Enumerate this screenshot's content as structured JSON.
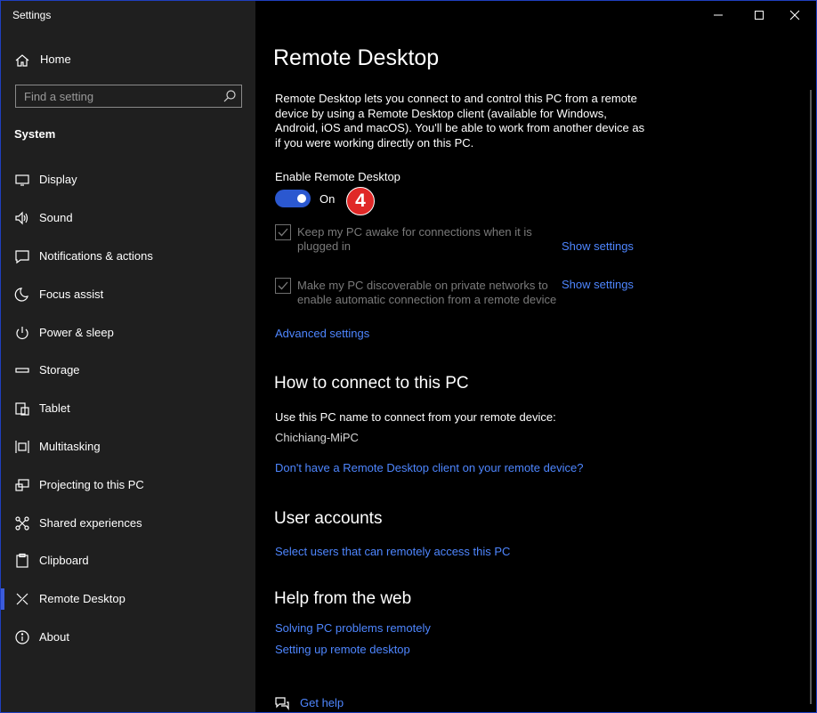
{
  "window": {
    "title": "Settings"
  },
  "sidebar": {
    "home_label": "Home",
    "search_placeholder": "Find a setting",
    "section_title": "System",
    "items": [
      {
        "label": "Display",
        "icon": "display-icon"
      },
      {
        "label": "Sound",
        "icon": "sound-icon"
      },
      {
        "label": "Notifications & actions",
        "icon": "notifications-icon"
      },
      {
        "label": "Focus assist",
        "icon": "moon-icon"
      },
      {
        "label": "Power & sleep",
        "icon": "power-icon"
      },
      {
        "label": "Storage",
        "icon": "storage-icon"
      },
      {
        "label": "Tablet",
        "icon": "tablet-icon"
      },
      {
        "label": "Multitasking",
        "icon": "multitasking-icon"
      },
      {
        "label": "Projecting to this PC",
        "icon": "projecting-icon"
      },
      {
        "label": "Shared experiences",
        "icon": "shared-icon"
      },
      {
        "label": "Clipboard",
        "icon": "clipboard-icon"
      },
      {
        "label": "Remote Desktop",
        "icon": "remote-desktop-icon",
        "active": true
      },
      {
        "label": "About",
        "icon": "info-icon"
      }
    ]
  },
  "main": {
    "title": "Remote Desktop",
    "description": [
      "Remote Desktop lets you connect to and control this PC from a remote",
      "device by using a Remote Desktop client (available for Windows,",
      "Android, iOS and macOS). You'll be able to work from another device as",
      "if you were working directly on this PC."
    ],
    "enable_label": "Enable Remote Desktop",
    "toggle_state": "On",
    "step_badge": "4",
    "checkbox_awake": {
      "lines": [
        "Keep my PC awake for connections when it is",
        "plugged in"
      ],
      "link": "Show settings"
    },
    "checkbox_discoverable": {
      "lines": [
        "Make my PC discoverable on private networks to",
        "enable automatic connection from a remote device"
      ],
      "link": "Show settings"
    },
    "advanced_link": "Advanced settings",
    "connect_heading": "How to connect to this PC",
    "connect_text": "Use this PC name to connect from your remote device:",
    "pc_name": "Chichiang-MiPC",
    "client_link": "Don't have a Remote Desktop client on your remote device?",
    "accounts_heading": "User accounts",
    "accounts_link": "Select users that can remotely access this PC",
    "help_heading": "Help from the web",
    "help_links": [
      "Solving PC problems remotely",
      "Setting up remote desktop"
    ],
    "get_help": "Get help"
  },
  "colors": {
    "accent": "#2b58d0",
    "link": "#4e86ff",
    "badge": "#e02827"
  }
}
